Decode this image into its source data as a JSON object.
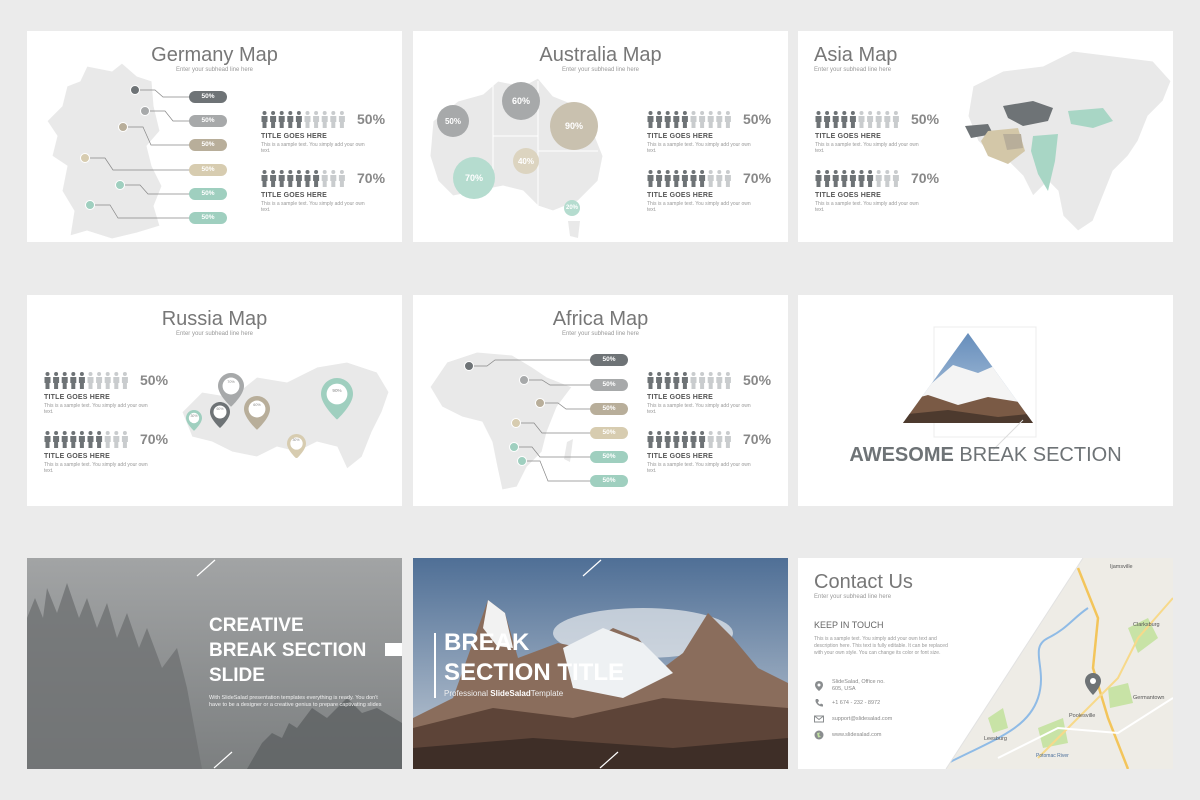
{
  "colors": {
    "dark": "#6e7376",
    "gray": "#a7a9aa",
    "taupe": "#b8ae9a",
    "beige": "#d7ccb0",
    "mint": "#9fcfbf",
    "light": "#c9ccce",
    "map": "#e9e9e9"
  },
  "slides": {
    "germany": {
      "title": "Germany Map",
      "subhead": "Enter your subhead line here",
      "pills": [
        "50%",
        "50%",
        "50%",
        "50%",
        "50%",
        "50%"
      ],
      "stats": [
        {
          "pct": "50%",
          "fill": 0.5,
          "title": "TITLE GOES HERE",
          "desc": "This is a sample text. You simply add your own text."
        },
        {
          "pct": "70%",
          "fill": 0.7,
          "title": "TITLE GOES HERE",
          "desc": "This is a sample text. You simply add your own text."
        }
      ]
    },
    "australia": {
      "title": "Australia Map",
      "subhead": "Enter your subhead line here",
      "bubbles": [
        "50%",
        "60%",
        "90%",
        "40%",
        "70%",
        "20%"
      ],
      "stats": [
        {
          "pct": "50%",
          "fill": 0.5,
          "title": "TITLE GOES HERE",
          "desc": "This is a sample text. You simply add your own text."
        },
        {
          "pct": "70%",
          "fill": 0.7,
          "title": "TITLE GOES HERE",
          "desc": "This is a sample text. You simply add your own text."
        }
      ]
    },
    "asia": {
      "title": "Asia Map",
      "subhead": "Enter your subhead line here",
      "stats": [
        {
          "pct": "50%",
          "fill": 0.5,
          "title": "TITLE GOES HERE",
          "desc": "This is a sample text. You simply add your own text."
        },
        {
          "pct": "70%",
          "fill": 0.7,
          "title": "TITLE GOES HERE",
          "desc": "This is a sample text. You simply add your own text."
        }
      ]
    },
    "russia": {
      "title": "Russia Map",
      "subhead": "Enter your subhead line here",
      "pins": [
        "30%",
        "70%",
        "60%",
        "60%",
        "90%",
        "30%"
      ],
      "stats": [
        {
          "pct": "50%",
          "fill": 0.5,
          "title": "TITLE GOES HERE",
          "desc": "This is a sample text. You simply add your own text."
        },
        {
          "pct": "70%",
          "fill": 0.7,
          "title": "TITLE GOES HERE",
          "desc": "This is a sample text. You simply add your own text."
        }
      ]
    },
    "africa": {
      "title": "Africa Map",
      "subhead": "Enter your subhead line here",
      "pills": [
        "50%",
        "50%",
        "50%",
        "50%",
        "50%",
        "50%"
      ],
      "stats": [
        {
          "pct": "50%",
          "fill": 0.5,
          "title": "TITLE GOES HERE",
          "desc": "This is a sample text. You simply add your own text."
        },
        {
          "pct": "70%",
          "fill": 0.7,
          "title": "TITLE GOES HERE",
          "desc": "This is a sample text. You simply add your own text."
        }
      ]
    },
    "awesome": {
      "bold": "AWESOME",
      "rest": "BREAK SECTION"
    },
    "creative": {
      "line1": "CREATIVE",
      "line2": "BREAK SECTION",
      "line3": "SLIDE",
      "desc": "With SlideSalad presentation templates everything is ready. You don't have to be a designer or a creative genius to prepare captivating slides"
    },
    "breaktitle": {
      "line1": "BREAK",
      "line2": "SECTION TITLE",
      "sub_pre": "Professional",
      "sub_brand": "SlideSalad",
      "sub_post": "Template"
    },
    "contact": {
      "title": "Contact Us",
      "subhead": "Enter your subhead line here",
      "heading": "KEEP IN TOUCH",
      "desc": "This is a sample text. You simply add your own text and description here. This text is fully editable. It can be replaced with your own style. You can change its color or font size.",
      "address": "SlideSalad, Office no. 605, USA",
      "phone": "+1 674 - 232 - 8972",
      "email": "support@slidesalad.com",
      "web": "www.slidesalad.com",
      "map_labels": [
        "Ijamsville",
        "Clarksburg",
        "Germantown",
        "Poolesville",
        "Leesburg",
        "Potomac River"
      ]
    }
  }
}
